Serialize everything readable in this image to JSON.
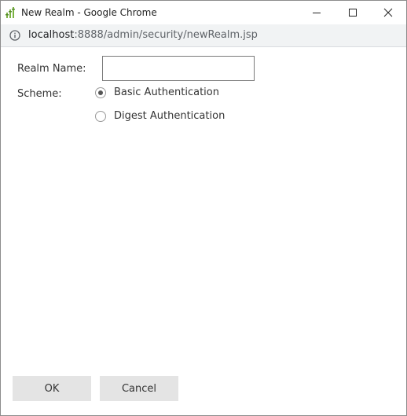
{
  "window": {
    "title": "New Realm - Google Chrome"
  },
  "addressbar": {
    "url_host": "localhost",
    "url_path": ":8888/admin/security/newRealm.jsp"
  },
  "form": {
    "realm_name_label": "Realm Name:",
    "realm_name_value": "",
    "scheme_label": "Scheme:",
    "scheme_options": [
      {
        "label": "Basic Authentication",
        "selected": true
      },
      {
        "label": "Digest Authentication",
        "selected": false
      }
    ]
  },
  "buttons": {
    "ok_label": "OK",
    "cancel_label": "Cancel"
  },
  "icons": {
    "app": "chrome-app-icon",
    "minimize": "minimize-icon",
    "maximize": "maximize-icon",
    "close": "close-icon",
    "info": "info-icon"
  }
}
